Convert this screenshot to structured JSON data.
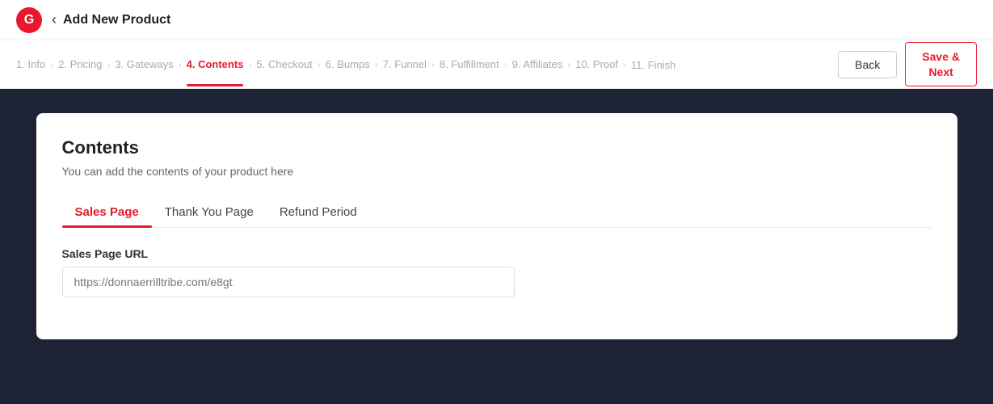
{
  "topbar": {
    "logo_letter": "G",
    "back_label": "‹",
    "title": "Add New Product"
  },
  "steps": [
    {
      "id": "info",
      "label": "1. Info",
      "active": false
    },
    {
      "id": "pricing",
      "label": "2. Pricing",
      "active": false
    },
    {
      "id": "gateways",
      "label": "3. Gateways",
      "active": false
    },
    {
      "id": "contents",
      "label": "4. Contents",
      "active": true
    },
    {
      "id": "checkout",
      "label": "5. Checkout",
      "active": false
    },
    {
      "id": "bumps",
      "label": "6. Bumps",
      "active": false
    },
    {
      "id": "funnel",
      "label": "7. Funnel",
      "active": false
    },
    {
      "id": "fulfillment",
      "label": "8. Fulfillment",
      "active": false
    },
    {
      "id": "affiliates",
      "label": "9. Affiliates",
      "active": false
    },
    {
      "id": "proof",
      "label": "10. Proof",
      "active": false
    },
    {
      "id": "finish",
      "label": "11. Finish",
      "active": false
    }
  ],
  "actions": {
    "back_label": "Back",
    "save_next_label": "Save &\nNext"
  },
  "card": {
    "title": "Contents",
    "subtitle": "You can add the contents of your product here",
    "tabs": [
      {
        "id": "sales-page",
        "label": "Sales Page",
        "active": true
      },
      {
        "id": "thank-you-page",
        "label": "Thank You Page",
        "active": false
      },
      {
        "id": "refund-period",
        "label": "Refund Period",
        "active": false
      }
    ],
    "fields": {
      "sales_page_url": {
        "label": "Sales Page URL",
        "placeholder": "https://donnaerrilltribe.com/e8gt",
        "value": ""
      }
    }
  }
}
